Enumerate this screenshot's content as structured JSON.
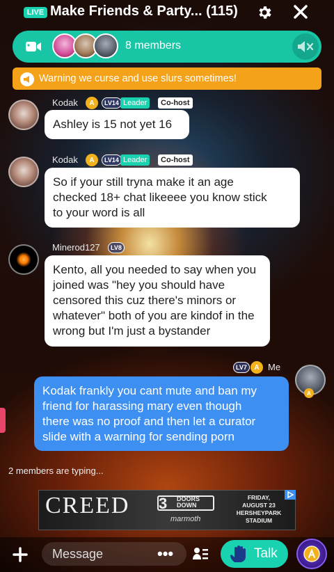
{
  "header": {
    "live_badge": "LIVE",
    "title": "Make Friends & Party... (115)"
  },
  "members_bar": {
    "label": "8 members"
  },
  "warning": {
    "text": "Warning we curse and use slurs sometimes!"
  },
  "messages": [
    {
      "sender": "Kodak",
      "level": "LV14",
      "role_leader": "Leader",
      "role_cohost": "Co-host",
      "text": "Ashley is 15 not yet 16"
    },
    {
      "sender": "Kodak",
      "level": "LV14",
      "role_leader": "Leader",
      "role_cohost": "Co-host",
      "lines": [
        "So if your still tryna make it an age",
        "checked 18+ chat likeeee you know stick",
        "to your word is all"
      ]
    },
    {
      "sender": "Minerod127",
      "level": "LV8",
      "lines": [
        "Kento, all you needed to say when you",
        "joined was \"hey you should have",
        "censored this cuz there's minors or",
        "whatever\" both of you are kindof in the",
        "wrong but I'm just a bystander"
      ]
    },
    {
      "sender": "Me",
      "level": "LV7",
      "lines": [
        "Kodak frankly you cant mute and ban my",
        "friend for harassing mary even though",
        "there was no proof and then let a curator",
        "slide with a warning for sending porn"
      ]
    }
  ],
  "typing_indicator": "2 members are typing...",
  "ad": {
    "brand": "CREED",
    "band_num": "3",
    "band_line1": "DOORS",
    "band_line2": "DOWN",
    "sponsor": "marmoth",
    "event_lines": [
      "FRIDAY,",
      "AUGUST 23",
      "HERSHEYPARK",
      "STADIUM"
    ]
  },
  "bottom_bar": {
    "message_placeholder": "Message",
    "talk_label": "Talk",
    "more_label": "•••"
  },
  "colors": {
    "accent": "#19d3b0",
    "warning": "#f5a21b",
    "my_bubble": "#3d8ff1"
  }
}
